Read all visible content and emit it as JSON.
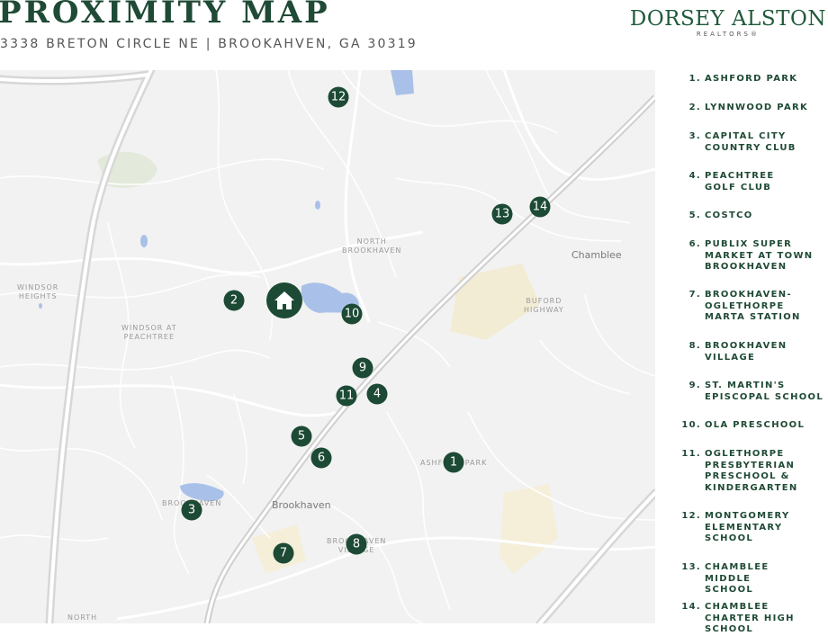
{
  "header": {
    "title": "PROXIMITY MAP",
    "address": "3338 BRETON CIRCLE NE  |  BROOKAHVEN, GA 30319"
  },
  "brand": {
    "name": "DORSEY ALSTON",
    "sub": "REALTORS®"
  },
  "map": {
    "labels": {
      "north_brookhaven": "NORTH\nBROOKHAVEN",
      "chamblee": "Chamblee",
      "buford_highway": "BUFORD\nHIGHWAY",
      "windsor_heights": "WINDSOR\nHEIGHTS",
      "windsor_at_peachtree": "WINDSOR AT\nPEACHTREE",
      "ashford_park": "ASHFORD PARK",
      "brookhaven_pond": "BROOKHAVEN",
      "brookhaven": "Brookhaven",
      "brookhaven_village": "BROOKHAVEN\nVILLAGE",
      "north_bottom": "NORTH"
    },
    "markers": [
      "1",
      "2",
      "3",
      "4",
      "5",
      "6",
      "7",
      "8",
      "9",
      "10",
      "11",
      "12",
      "13",
      "14"
    ],
    "home_icon": "house-icon"
  },
  "legend": [
    {
      "num": "1.",
      "label": "ASHFORD PARK"
    },
    {
      "num": "2.",
      "label": "LYNNWOOD PARK"
    },
    {
      "num": "3.",
      "label": "CAPITAL CITY COUNTRY CLUB"
    },
    {
      "num": "4.",
      "label": "PEACHTREE GOLF CLUB"
    },
    {
      "num": "5.",
      "label": "COSTCO"
    },
    {
      "num": "6.",
      "label": "PUBLIX SUPER MARKET AT TOWN BROOKHAVEN"
    },
    {
      "num": "7.",
      "label": "BROOKHAVEN-OGLETHORPE MARTA STATION"
    },
    {
      "num": "8.",
      "label": "BROOKHAVEN VILLAGE"
    },
    {
      "num": "9.",
      "label": "ST. MARTIN'S EPISCOPAL SCHOOL"
    },
    {
      "num": "10.",
      "label": "OLA PRESCHOOL"
    },
    {
      "num": "11.",
      "label": "OGLETHORPE PRESBYTERIAN PRESCHOOL & KINDERGARTEN"
    },
    {
      "num": "12.",
      "label": "MONTGOMERY ELEMENTARY SCHOOL"
    },
    {
      "num": "13.",
      "label": "CHAMBLEE MIDDLE SCHOOL"
    },
    {
      "num": "14.",
      "label": "CHAMBLEE CHARTER HIGH SCHOOL"
    }
  ],
  "colors": {
    "accent": "#1c4a35",
    "map_bg": "#f2f2f2",
    "road": "#ffffff",
    "water": "#a9c1e8",
    "park": "#dfe8d8",
    "yellow_zone": "#f3ecd2"
  }
}
